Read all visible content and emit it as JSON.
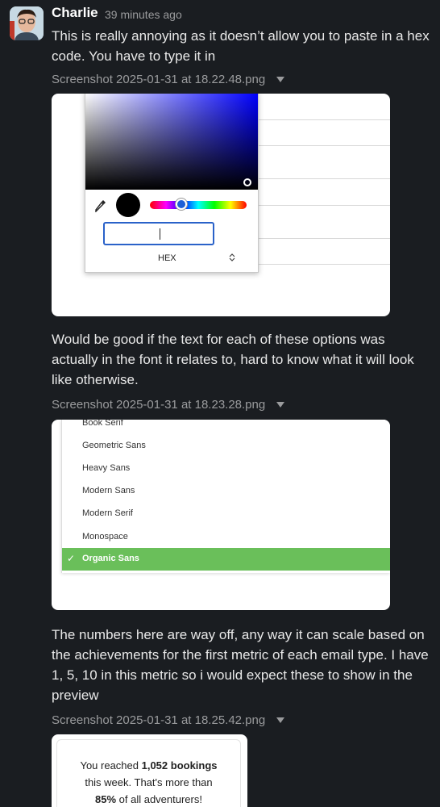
{
  "message": {
    "author": "Charlie",
    "timestamp": "39 minutes ago"
  },
  "blocks": [
    {
      "text": "This is really annoying as it doesn’t allow you to paste in a hex code. You have to type it in",
      "filename": "Screenshot 2025-01-31 at 18.22.48.png"
    },
    {
      "text": "Would be good if the text for each of these options was actually in the font it relates to, hard to know what it will look like otherwise.",
      "filename": "Screenshot 2025-01-31 at 18.23.28.png"
    },
    {
      "text": "The numbers here are way off, any way it can scale based on the achievements for the first metric of each email type. I have 1, 5, 10 in this metric so i would expect these to show in the preview",
      "filename": "Screenshot 2025-01-31 at 18.25.42.png"
    }
  ],
  "screenshot1": {
    "hex_label": "HEX",
    "toggle_icon": "⌃⌄",
    "hue_knob_color": "#1e5fd6",
    "input_border_color": "#2a62c9"
  },
  "screenshot2": {
    "font_options": [
      "Book Serif",
      "Geometric Sans",
      "Heavy Sans",
      "Modern Sans",
      "Modern Serif",
      "Monospace"
    ],
    "selected_option": "Organic Sans",
    "selected_color": "#6abf5a"
  },
  "screenshot3": {
    "line1_prefix": "You reached ",
    "line1_bold": "1,052 bookings",
    "line2": "this week. That's more than",
    "line3_bold": "85%",
    "line3_suffix": " of all adventurers!"
  }
}
